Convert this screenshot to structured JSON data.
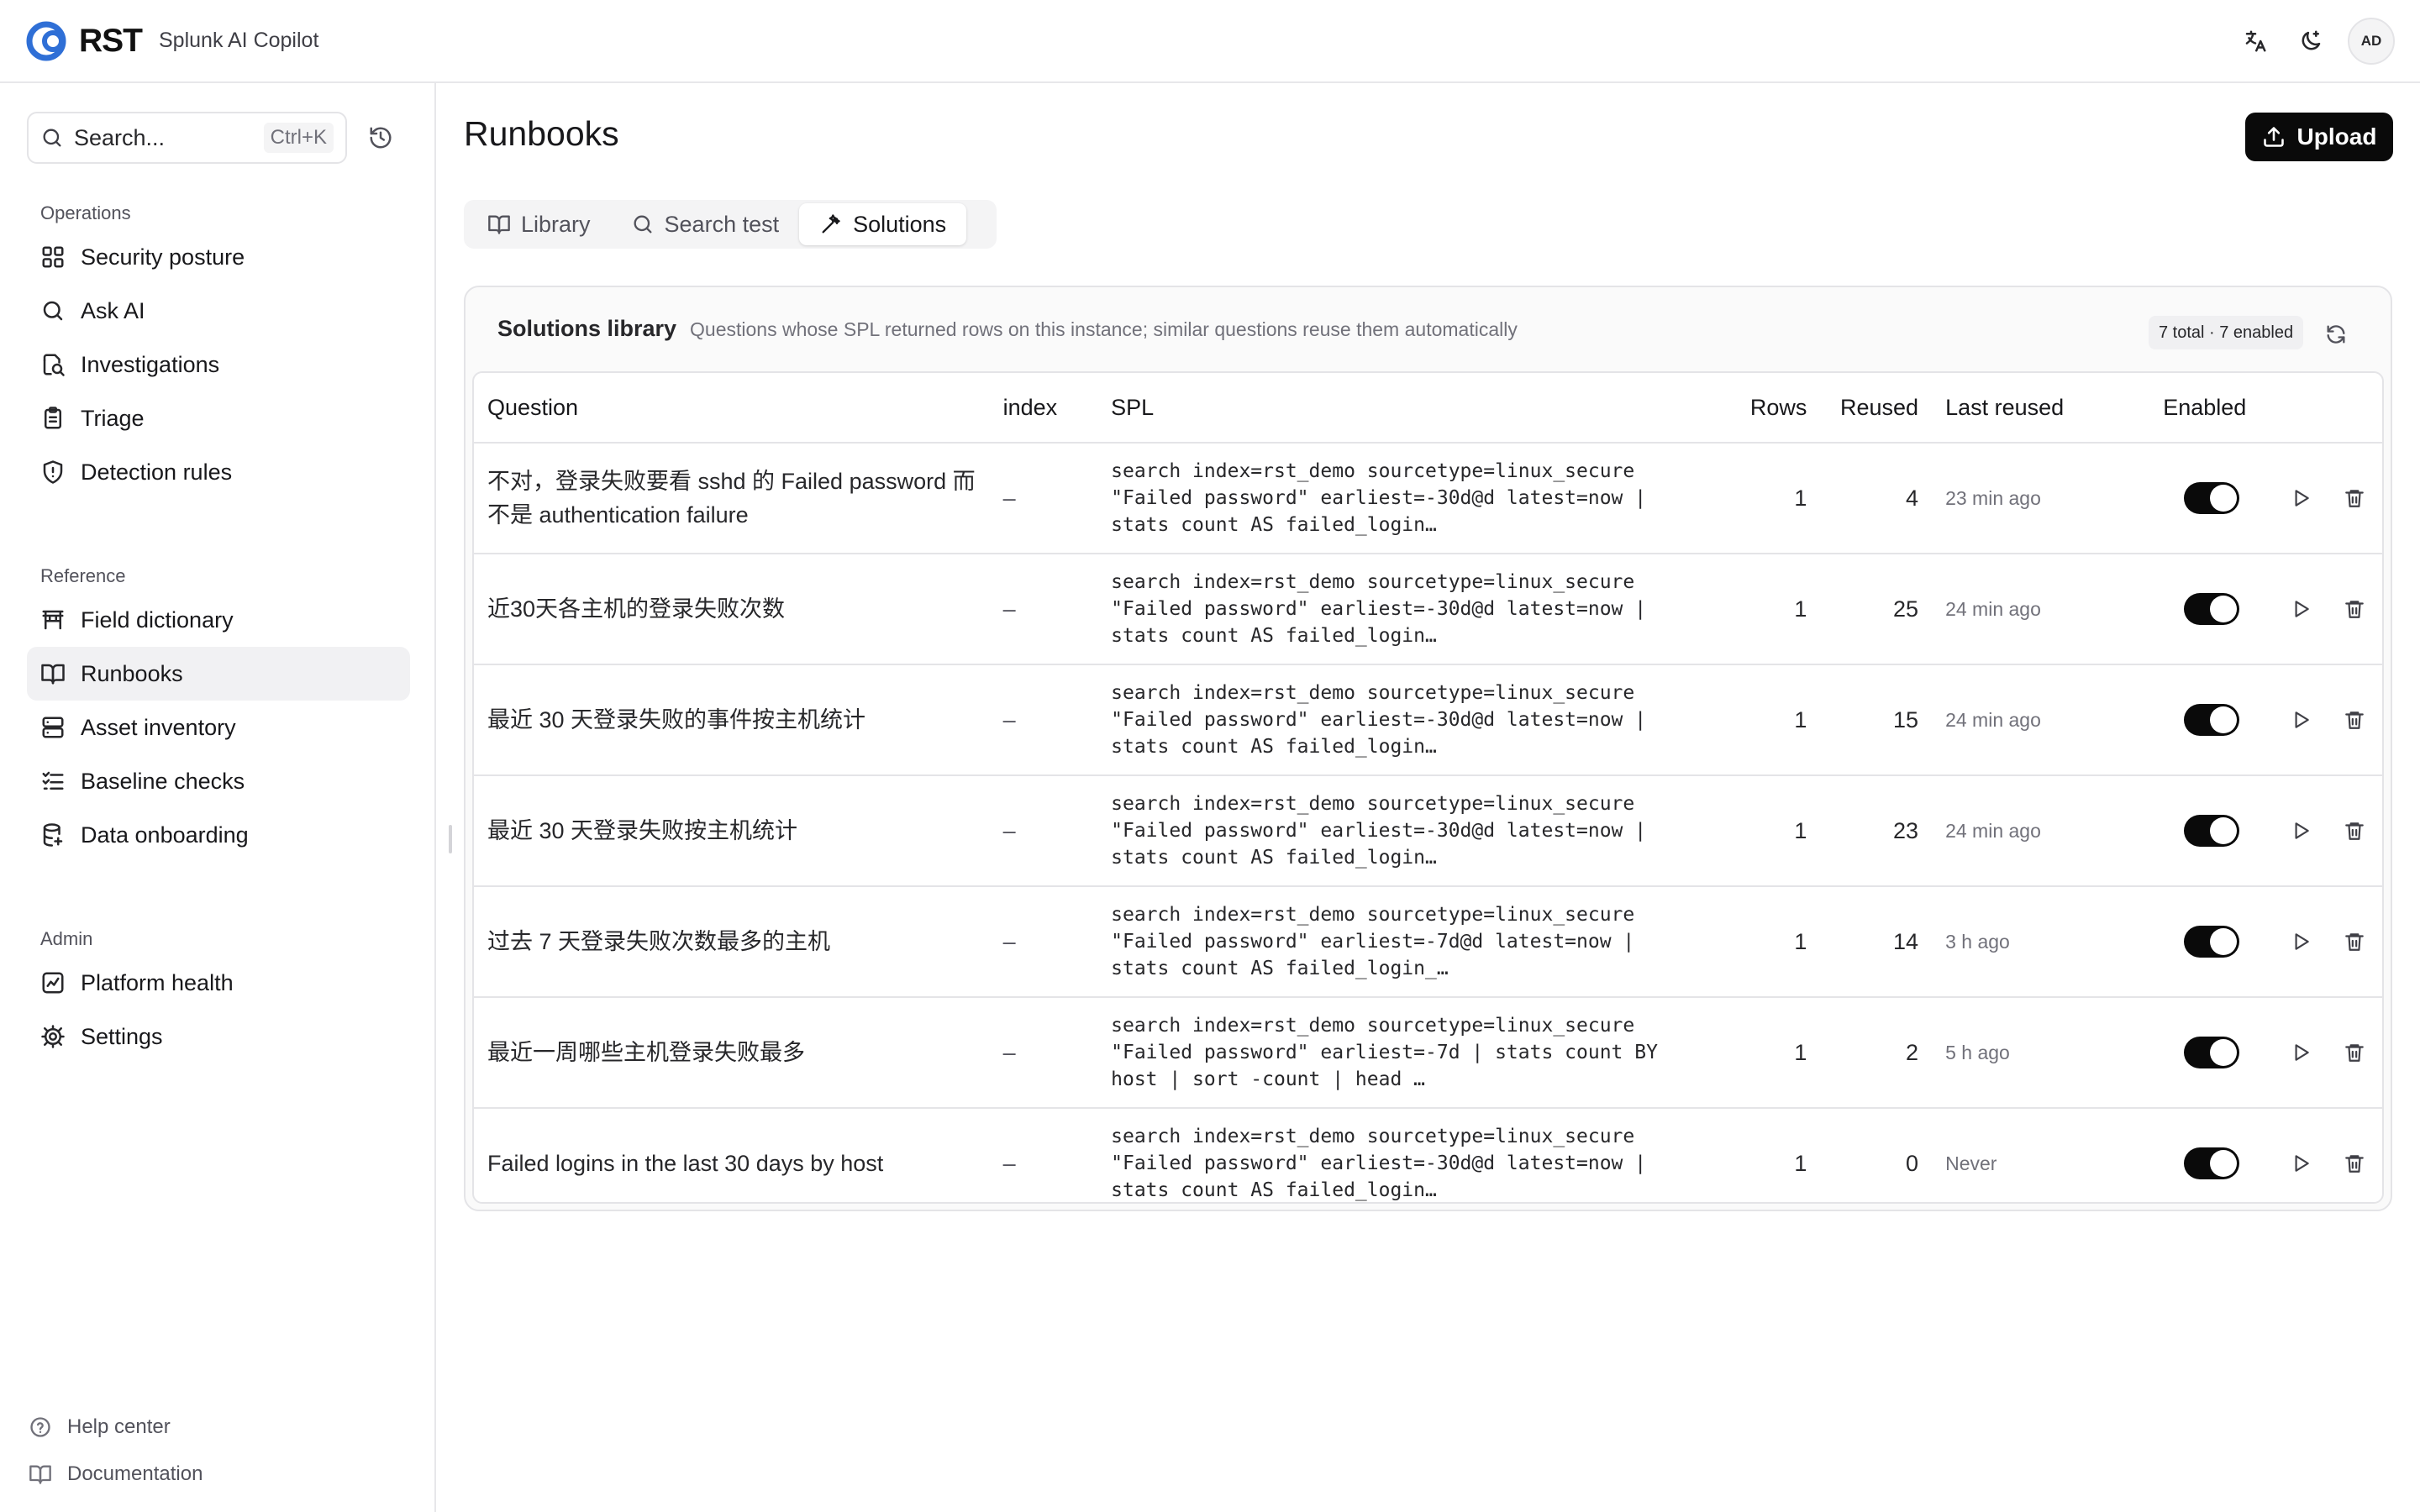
{
  "header": {
    "logo_text": "RST",
    "app_title": "Splunk AI Copilot",
    "avatar_initials": "AD",
    "icons": [
      "translate-icon",
      "moon-icon"
    ]
  },
  "sidebar": {
    "search_placeholder": "Search...",
    "search_shortcut": "Ctrl+K",
    "sections": [
      {
        "heading": "Operations",
        "items": [
          {
            "label": "Security posture",
            "icon": "dashboard-grid-icon",
            "active": false
          },
          {
            "label": "Ask AI",
            "icon": "search-icon",
            "active": false
          },
          {
            "label": "Investigations",
            "icon": "investigation-icon",
            "active": false
          },
          {
            "label": "Triage",
            "icon": "clipboard-icon",
            "active": false
          },
          {
            "label": "Detection rules",
            "icon": "shield-alert-icon",
            "active": false
          }
        ]
      },
      {
        "heading": "Reference",
        "items": [
          {
            "label": "Field dictionary",
            "icon": "table-icon",
            "active": false
          },
          {
            "label": "Runbooks",
            "icon": "book-open-icon",
            "active": true
          },
          {
            "label": "Asset inventory",
            "icon": "server-icon",
            "active": false
          },
          {
            "label": "Baseline checks",
            "icon": "list-checks-icon",
            "active": false
          },
          {
            "label": "Data onboarding",
            "icon": "database-icon",
            "active": false
          }
        ]
      },
      {
        "heading": "Admin",
        "items": [
          {
            "label": "Platform health",
            "icon": "activity-chart-icon",
            "active": false
          },
          {
            "label": "Settings",
            "icon": "gear-icon",
            "active": false
          }
        ]
      }
    ],
    "footer": [
      {
        "label": "Help center",
        "icon": "help-circle-icon"
      },
      {
        "label": "Documentation",
        "icon": "book-icon"
      }
    ]
  },
  "main": {
    "title": "Runbooks",
    "upload_label": "Upload",
    "tabs": [
      {
        "label": "Library",
        "icon": "book-open-icon",
        "active": false
      },
      {
        "label": "Search test",
        "icon": "search-icon",
        "active": false
      },
      {
        "label": "Solutions",
        "icon": "sparkle-wand-icon",
        "active": true
      }
    ],
    "panel": {
      "title": "Solutions library",
      "subtitle": "Questions whose SPL returned rows on this instance; similar questions reuse them automatically",
      "count": "7 total · 7 enabled"
    },
    "table": {
      "headers": {
        "question": "Question",
        "index": "index",
        "spl": "SPL",
        "rows": "Rows",
        "reused": "Reused",
        "last_reused": "Last reused",
        "enabled": "Enabled"
      },
      "rows": [
        {
          "question": "不对，登录失败要看 sshd 的 Failed password 而不是 authentication failure",
          "index": "–",
          "spl": "search index=rst_demo sourcetype=linux_secure\n\"Failed password\" earliest=-30d@d latest=now |\nstats count AS failed_login…",
          "rows": "1",
          "reused": "4",
          "last_reused": "23 min ago",
          "enabled": true
        },
        {
          "question": "近30天各主机的登录失败次数",
          "index": "–",
          "spl": "search index=rst_demo sourcetype=linux_secure\n\"Failed password\" earliest=-30d@d latest=now |\nstats count AS failed_login…",
          "rows": "1",
          "reused": "25",
          "last_reused": "24 min ago",
          "enabled": true
        },
        {
          "question": "最近 30 天登录失败的事件按主机统计",
          "index": "–",
          "spl": "search index=rst_demo sourcetype=linux_secure\n\"Failed password\" earliest=-30d@d latest=now |\nstats count AS failed_login…",
          "rows": "1",
          "reused": "15",
          "last_reused": "24 min ago",
          "enabled": true
        },
        {
          "question": "最近 30 天登录失败按主机统计",
          "index": "–",
          "spl": "search index=rst_demo sourcetype=linux_secure\n\"Failed password\" earliest=-30d@d latest=now |\nstats count AS failed_login…",
          "rows": "1",
          "reused": "23",
          "last_reused": "24 min ago",
          "enabled": true
        },
        {
          "question": "过去 7 天登录失败次数最多的主机",
          "index": "–",
          "spl": "search index=rst_demo sourcetype=linux_secure\n\"Failed password\" earliest=-7d@d latest=now |\nstats count AS failed_login_…",
          "rows": "1",
          "reused": "14",
          "last_reused": "3 h ago",
          "enabled": true
        },
        {
          "question": "最近一周哪些主机登录失败最多",
          "index": "–",
          "spl": "search index=rst_demo sourcetype=linux_secure\n\"Failed password\" earliest=-7d | stats count BY\nhost | sort -count | head …",
          "rows": "1",
          "reused": "2",
          "last_reused": "5 h ago",
          "enabled": true
        },
        {
          "question": "Failed logins in the last 30 days by host",
          "index": "–",
          "spl": "search index=rst_demo sourcetype=linux_secure\n\"Failed password\" earliest=-30d@d latest=now |\nstats count AS failed_login…",
          "rows": "1",
          "reused": "0",
          "last_reused": "Never",
          "enabled": true
        }
      ]
    }
  }
}
